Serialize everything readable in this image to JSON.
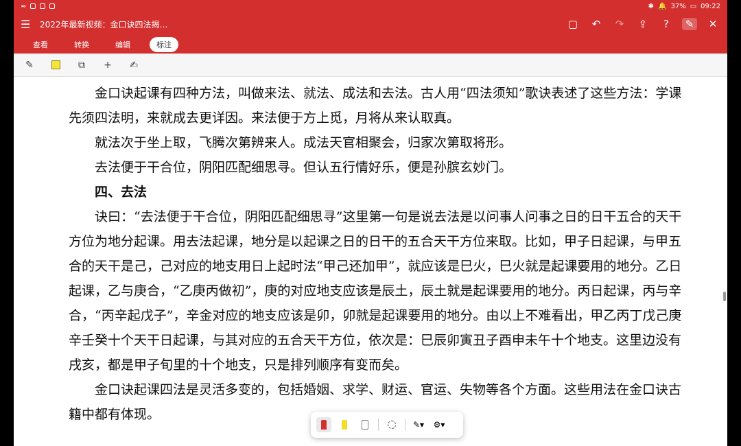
{
  "status": {
    "time": "09:22",
    "battery": "37%"
  },
  "header": {
    "title": "2022年最新视频：金口诀四法揭…"
  },
  "tabs": [
    {
      "label": "查看",
      "active": false
    },
    {
      "label": "转换",
      "active": false
    },
    {
      "label": "编辑",
      "active": false
    },
    {
      "label": "标注",
      "active": true
    }
  ],
  "colors": {
    "brand": "#d32f2f",
    "highlight": "#f4e53b"
  },
  "content": {
    "p1": "金口诀起课有四种方法，叫做来法、就法、成法和去法。古人用“四法须知”歌诀表述了这些方法：学课先须四法明，来就成去更详因。来法便于方上觅，月将从来认取真。",
    "p2": "就法次于坐上取，飞腾次第辨来人。成法天官相聚会，归家次第取将形。",
    "p3": "去法便于干合位，阴阳匹配细思寻。但认五行情好乐，便是孙膑玄妙门。",
    "heading": "四、去法",
    "p4": "诀曰：“去法便于干合位，阴阳匹配细思寻”这里第一句是说去法是以问事人问事之日的日干五合的天干方位为地分起课。用去法起课，地分是以起课之日的日干的五合天干方位来取。比如，甲子日起课，与甲五合的天干是己，己对应的地支用日上起时法“甲己还加甲”，就应该是巳火，巳火就是起课要用的地分。乙日起课，乙与庚合，“乙庚丙做初”，庚的对应地支应该是辰土，辰土就是起课要用的地分。丙日起课，丙与辛合，“丙辛起戊子”，辛金对应的地支应该是卯，卯就是起课要用的地分。由以上不难看出，甲乙丙丁戊己庚辛壬癸十个天干日起课，与其对应的五合天干方位，依次是：巳辰卯寅丑子酉申未午十个地支。这里边没有戌亥，都是甲子旬里的十个地支，只是排列顺序有变而矣。",
    "p5": "金口诀起课四法是灵活多变的，包括婚姻、求学、财运、官运、失物等各个方面。这些用法在金口诀古籍中都有体现。"
  }
}
